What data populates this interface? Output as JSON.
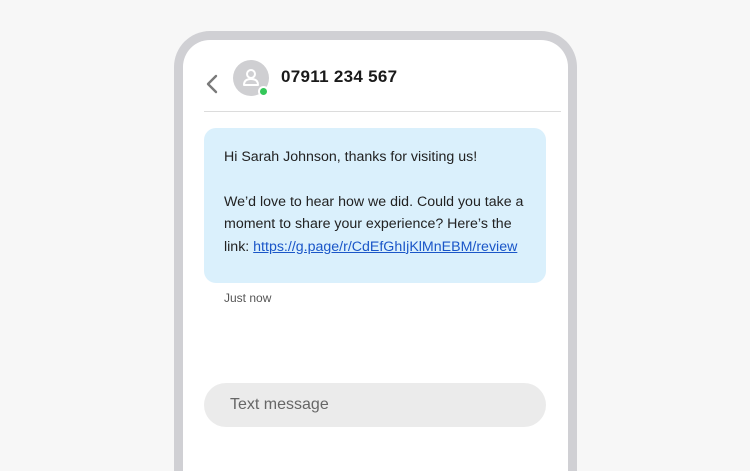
{
  "header": {
    "contact_number": "07911 234 567",
    "back_icon": "chevron-left-icon",
    "avatar_icon": "person-icon",
    "status": "online",
    "status_color": "#34c759"
  },
  "message": {
    "greeting": "Hi Sarah Johnson, thanks for visiting us!",
    "body": "We’d love to hear how we did. Could you take a moment to share your experience? Here’s the link: ",
    "link": "https://g.page/r/CdEfGhIjKlMnEBM/review",
    "timestamp": "Just now",
    "bubble_color": "#daf0fc"
  },
  "composer": {
    "placeholder": "Text message",
    "value": ""
  }
}
